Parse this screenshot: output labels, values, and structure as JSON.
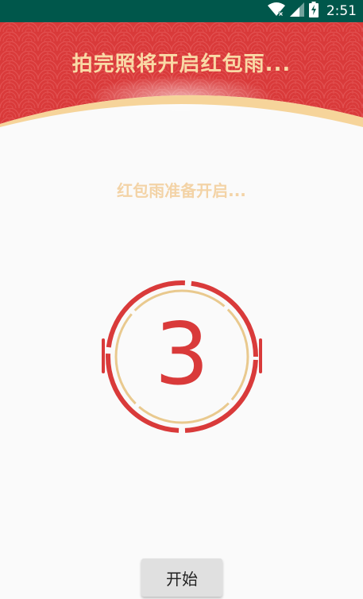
{
  "status_bar": {
    "time": "2:51",
    "icons": [
      "wifi-icon",
      "signal-icon",
      "battery-charging-icon"
    ],
    "background": "#00574b"
  },
  "header": {
    "title": "拍完照将开启红包雨...",
    "background": "#d93a3a",
    "title_color": "#f9d9a6"
  },
  "main": {
    "subtitle": "红包雨准备开启...",
    "countdown": "3",
    "accent": "#d93a3a",
    "ring_gold": "#e9c98e"
  },
  "start_button": {
    "label": "开始"
  }
}
